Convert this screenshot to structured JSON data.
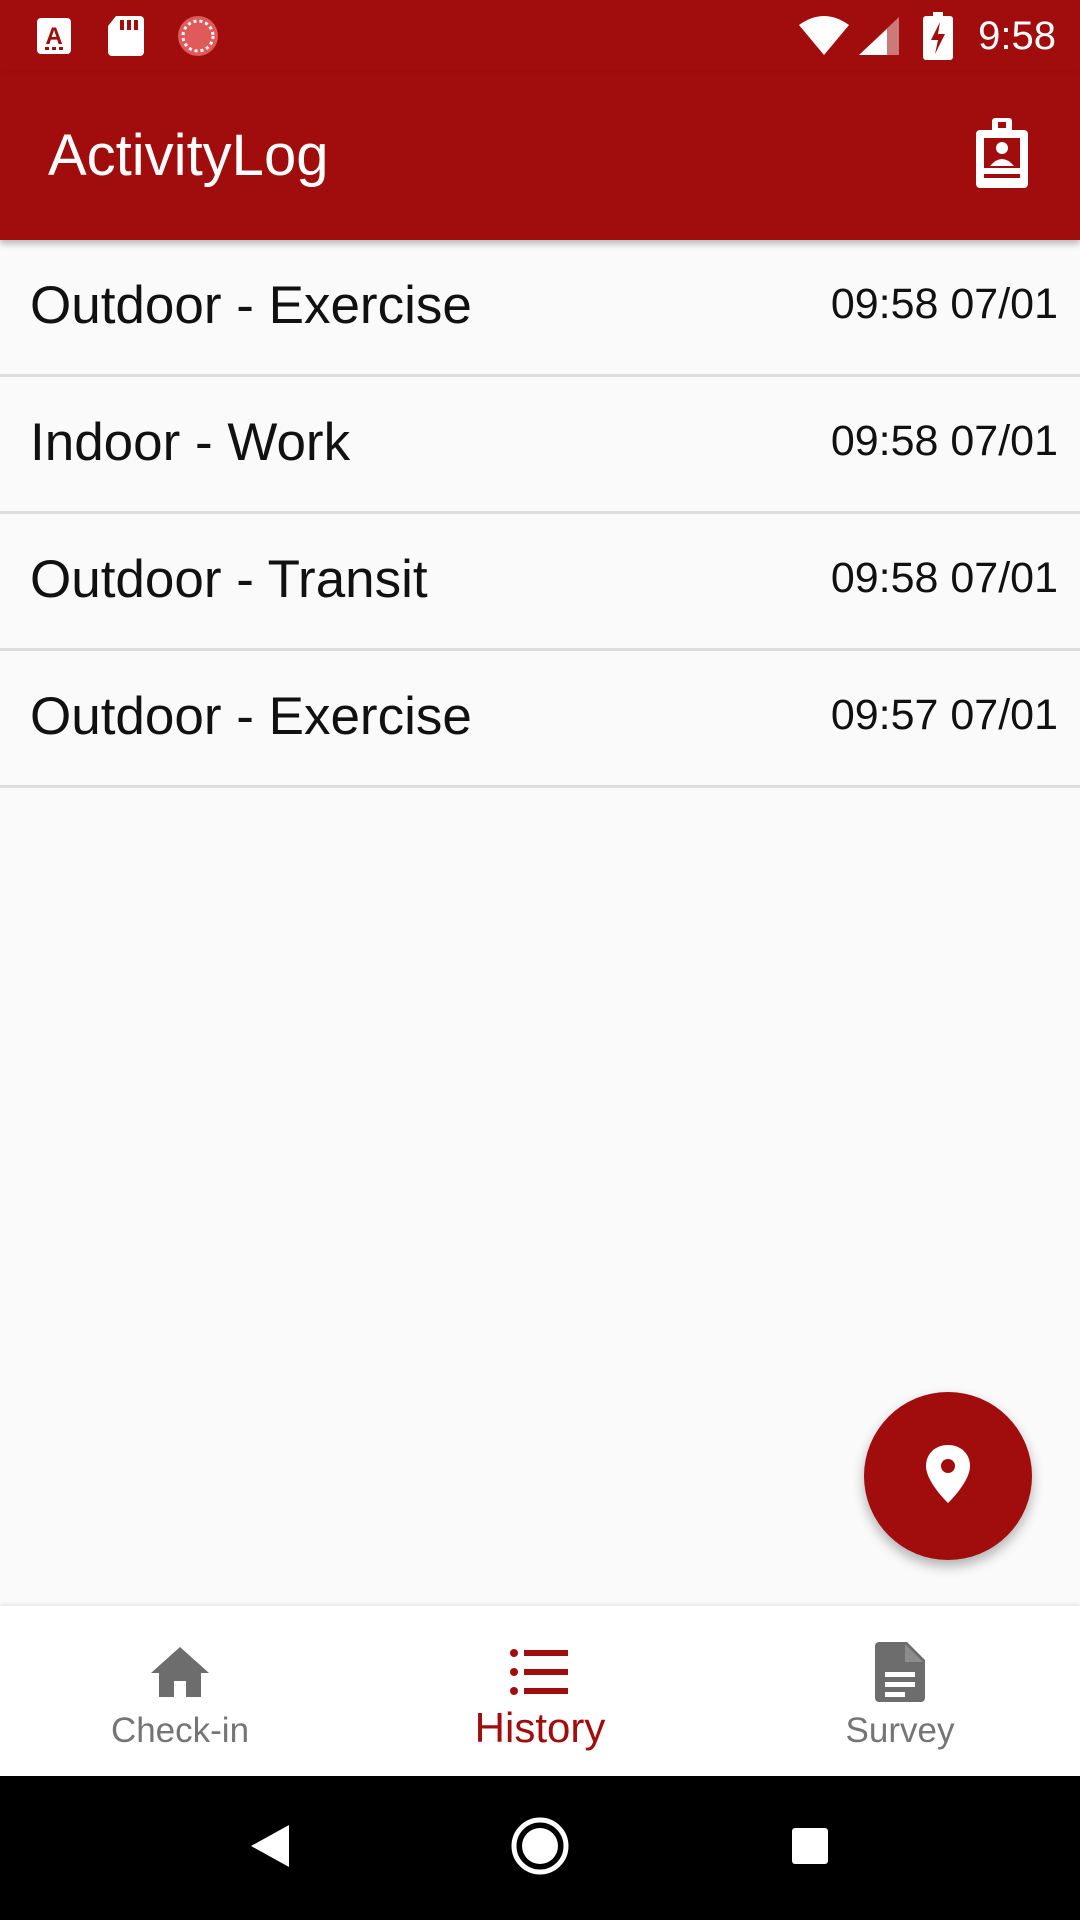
{
  "status_bar": {
    "time": "9:58",
    "left_icons": [
      "font-app-icon",
      "sd-card-icon",
      "sync-icon"
    ],
    "right_icons": [
      "wifi-icon",
      "cell-signal-icon",
      "battery-charging-icon"
    ]
  },
  "app_bar": {
    "title": "ActivityLog",
    "action_icon": "contact-badge-icon"
  },
  "history": {
    "items": [
      {
        "label": "Outdoor - Exercise",
        "time": "09:58 07/01"
      },
      {
        "label": "Indoor - Work",
        "time": "09:58 07/01"
      },
      {
        "label": "Outdoor - Transit",
        "time": "09:58 07/01"
      },
      {
        "label": "Outdoor - Exercise",
        "time": "09:57 07/01"
      }
    ]
  },
  "fab": {
    "icon": "location-pin-icon"
  },
  "bottom_nav": {
    "items": [
      {
        "label": "Check-in",
        "icon": "home-icon",
        "active": false
      },
      {
        "label": "History",
        "icon": "list-icon",
        "active": true
      },
      {
        "label": "Survey",
        "icon": "document-icon",
        "active": false
      }
    ]
  },
  "system_nav": {
    "buttons": [
      "back-icon",
      "home-circle-icon",
      "recents-icon"
    ]
  },
  "colors": {
    "primary": "#a10c0c",
    "background": "#fafafa",
    "divider": "#dedede",
    "inactive": "#757575"
  }
}
